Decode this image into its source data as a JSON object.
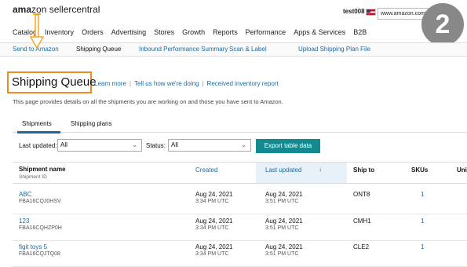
{
  "header": {
    "logo_bold": "ama",
    "logo_rest": "zon sellercentral",
    "user": "test008",
    "domain": "www.amazon.com",
    "step_badge": "2"
  },
  "nav": {
    "items": [
      "Catalog",
      "Inventory",
      "Orders",
      "Advertising",
      "Stores",
      "Growth",
      "Reports",
      "Performance",
      "Apps & Services",
      "B2B"
    ]
  },
  "subnav": {
    "items": [
      "Send to Amazon",
      "Shipping Queue",
      "Inbound Performance Summary",
      "Scan & Label",
      "Upload Shipping Plan File"
    ],
    "active": "Shipping Queue"
  },
  "page": {
    "title": "Shipping Queue",
    "learn_more": "Learn more",
    "feedback": "Tell us how we're doing",
    "received": "Received inventory report",
    "description": "This page provides details on all the shipments you are working on and those you have sent to Amazon."
  },
  "tabs": {
    "shipments": "Shipments",
    "plans": "Shipping plans"
  },
  "filters": {
    "last_updated_label": "Last updated:",
    "last_updated_value": "All",
    "status_label": "Status:",
    "status_value": "All",
    "export_label": "Export table data"
  },
  "table": {
    "headers": {
      "name": "Shipment name",
      "name_sub": "Shipment ID",
      "created": "Created",
      "updated": "Last updated",
      "ship_to": "Ship to",
      "skus": "SKUs",
      "units": "Unit"
    },
    "rows": [
      {
        "name": "ABC",
        "id": "FBA16CQJ0HSV",
        "created_date": "Aug 24, 2021",
        "created_time": "3:34 PM UTC",
        "updated_date": "Aug 24, 2021",
        "updated_time": "3:51 PM UTC",
        "ship_to": "ONT8",
        "skus": "1"
      },
      {
        "name": "123",
        "id": "FBA16CQHZP0H",
        "created_date": "Aug 24, 2021",
        "created_time": "3:34 PM UTC",
        "updated_date": "Aug 24, 2021",
        "updated_time": "3:51 PM UTC",
        "ship_to": "CMH1",
        "skus": "1"
      },
      {
        "name": "figit toys 5",
        "id": "FBA16CQJTQ08",
        "created_date": "Aug 24, 2021",
        "created_time": "3:34 PM UTC",
        "updated_date": "Aug 24, 2021",
        "updated_time": "3:51 PM UTC",
        "ship_to": "CLE2",
        "skus": "1"
      }
    ]
  },
  "colors": {
    "link": "#1e6a9c",
    "accent_button": "#138a90",
    "highlight_box": "#f08a24"
  }
}
